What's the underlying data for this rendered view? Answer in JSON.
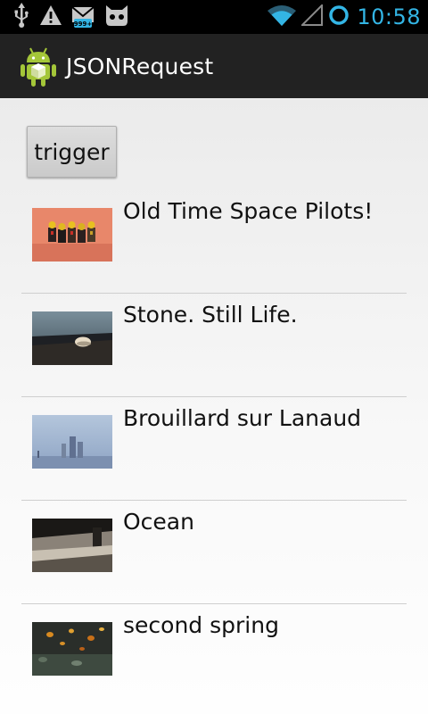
{
  "status_bar": {
    "time": "10:58",
    "left_icons": [
      "usb-icon",
      "warning-icon",
      "mail-icon",
      "cat-icon"
    ],
    "right_icons": [
      "wifi-icon",
      "signal-icon",
      "sync-ring-icon"
    ],
    "mail_badge": "999+"
  },
  "action_bar": {
    "title": "JSONRequest",
    "icon": "android-app-icon"
  },
  "trigger_label": "trigger",
  "items": [
    {
      "title": "Old Time Space Pilots!",
      "thumb": "lego-figures-photo"
    },
    {
      "title": "Stone. Still Life.",
      "thumb": "stone-on-wood-photo"
    },
    {
      "title": "Brouillard sur Lanaud",
      "thumb": "foggy-statues-photo"
    },
    {
      "title": "Ocean",
      "thumb": "bridge-ocean-photo"
    },
    {
      "title": "second spring",
      "thumb": "autumn-leaves-photo"
    }
  ],
  "colors": {
    "status_bar": "#000000",
    "action_bar": "#222222",
    "clock": "#33b5e5",
    "android_green": "#a4c639"
  }
}
